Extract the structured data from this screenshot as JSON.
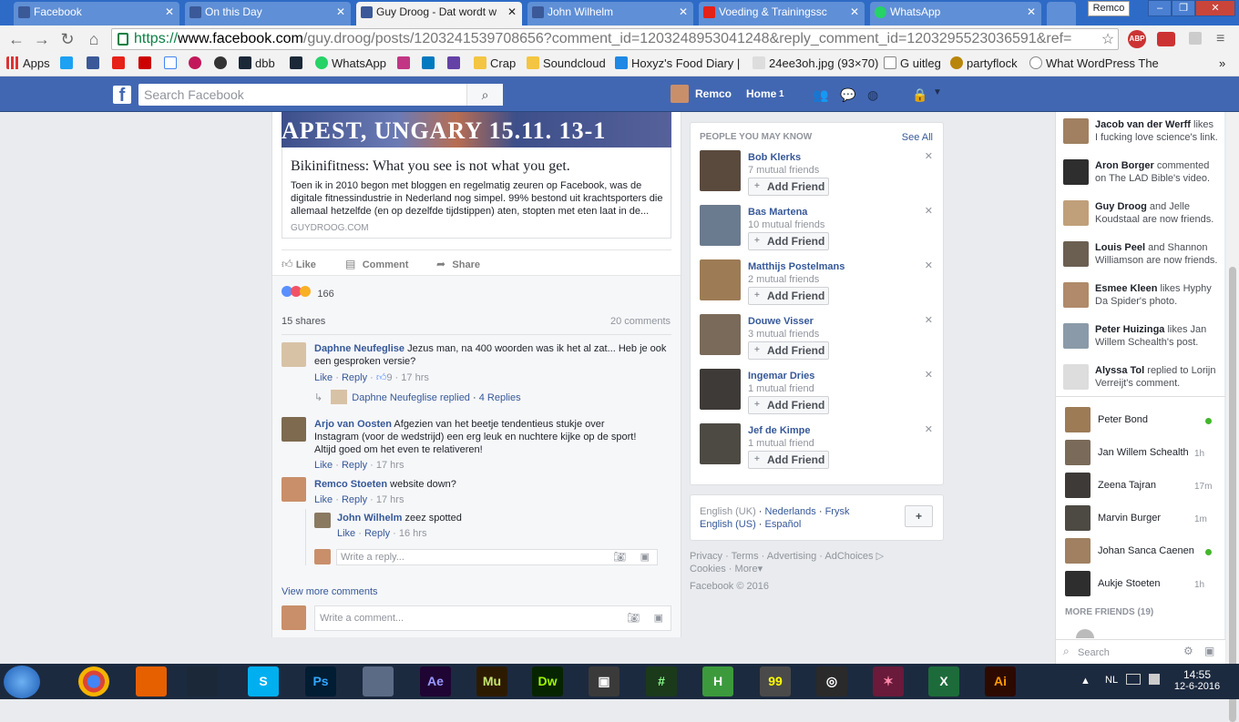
{
  "browser": {
    "tabs": [
      {
        "title": "Facebook",
        "color": "#3b5998",
        "active": false
      },
      {
        "title": "On this Day",
        "color": "#3b5998",
        "active": false
      },
      {
        "title": "Guy Droog - Dat wordt w",
        "color": "#3b5998",
        "active": true
      },
      {
        "title": "John Wilhelm",
        "color": "#3b5998",
        "active": false
      },
      {
        "title": "Voeding & Trainingssc",
        "color": "#e62117",
        "active": false
      },
      {
        "title": "WhatsApp",
        "color": "#25d366",
        "active": false
      }
    ],
    "profile": "Remco",
    "url_scheme": "https://",
    "url_host": "www.facebook.com",
    "url_path": "/guy.droog/posts/1203241539708656?comment_id=1203248953041248&reply_comment_id=1203295523036591&ref=",
    "bookmarks": [
      "Apps",
      "dbb",
      "WhatsApp",
      "Crap",
      "Soundcloud",
      "Hoxyz's Food Diary |",
      "24ee3oh.jpg (93×70)",
      "G uitleg",
      "partyflock",
      "What WordPress The"
    ]
  },
  "fb_header": {
    "search_placeholder": "Search Facebook",
    "user": "Remco",
    "home": "Home",
    "home_count": "1"
  },
  "post": {
    "image_text": "APEST, UNGARY 15.11. 13-1",
    "link_title": "Bikinifitness: What you see is not what you get.",
    "link_desc": "Toen ik in 2010 begon met bloggen en regelmatig zeuren op Facebook, was de digitale fitnessindustrie in Nederland nog simpel. 99% bestond uit krachtsporters die allemaal hetzelfde (en op dezelfde tijdstippen) aten, stopten met eten laat in de...",
    "link_domain": "GUYDROOG.COM",
    "like": "Like",
    "comment": "Comment",
    "share": "Share",
    "reactions_count": "166",
    "shares": "15 shares",
    "comments_count": "20 comments",
    "view_more": "View more comments",
    "write_comment": "Write a comment...",
    "write_reply": "Write a reply..."
  },
  "comments": [
    {
      "name": "Daphne Neufeglise",
      "text": "Jezus man, na 400 woorden was ik het al zat... Heb je ook een gesproken versie?",
      "like": "Like",
      "reply": "Reply",
      "likes": "9",
      "time": "17 hrs",
      "replied_by": "Daphne Neufeglise replied",
      "replies": "4 Replies"
    },
    {
      "name": "Arjo van Oosten",
      "text": "Afgezien van het beetje tendentieus stukje over Instagram (voor de wedstrijd) een erg leuk en nuchtere kijke op de sport! Altijd goed om het even te relativeren!",
      "like": "Like",
      "reply": "Reply",
      "time": "17 hrs"
    },
    {
      "name": "Remco Stoeten",
      "text": "website down?",
      "like": "Like",
      "reply": "Reply",
      "time": "17 hrs"
    },
    {
      "name": "John Wilhelm",
      "text": "zeez spotted",
      "like": "Like",
      "reply": "Reply",
      "time": "16 hrs"
    }
  ],
  "pymk": {
    "title": "PEOPLE YOU MAY KNOW",
    "see_all": "See All",
    "add_label": "Add Friend",
    "people": [
      {
        "name": "Bob Klerks",
        "mutual": "7 mutual friends"
      },
      {
        "name": "Bas Martena",
        "mutual": "10 mutual friends"
      },
      {
        "name": "Matthijs Postelmans",
        "mutual": "2 mutual friends"
      },
      {
        "name": "Douwe Visser",
        "mutual": "3 mutual friends"
      },
      {
        "name": "Ingemar Dries",
        "mutual": "1 mutual friend"
      },
      {
        "name": "Jef de Kimpe",
        "mutual": "1 mutual friend"
      }
    ]
  },
  "languages": {
    "current": "English (UK)",
    "others": [
      "Nederlands",
      "Frysk",
      "English (US)",
      "Español"
    ]
  },
  "footer": {
    "links": [
      "Privacy",
      "Terms",
      "Advertising",
      "AdChoices",
      "Cookies",
      "More"
    ],
    "copyright": "Facebook © 2016"
  },
  "ticker": [
    {
      "name": "Jacob van der Werff",
      "text": " likes I fucking love science's link."
    },
    {
      "name": "Aron Borger",
      "text": " commented on The LAD Bible's video."
    },
    {
      "name": "Guy Droog",
      "text": " and Jelle Koudstaal are now friends."
    },
    {
      "name": "Louis Peel",
      "text": " and Shannon Williamson are now friends."
    },
    {
      "name": "Esmee Kleen",
      "text": " likes Hyphy Da Spider's photo."
    },
    {
      "name": "Peter Huizinga",
      "text": " likes Jan Willem Schealth's post."
    },
    {
      "name": "Alyssa Tol",
      "text": " replied to Lorijn Verreijt's comment."
    }
  ],
  "chat": {
    "friends": [
      {
        "name": "Peter Bond",
        "status": "online"
      },
      {
        "name": "Jan Willem Schealth",
        "status": "1h"
      },
      {
        "name": "Zeena Tajran",
        "status": "17m"
      },
      {
        "name": "Marvin Burger",
        "status": "1m"
      },
      {
        "name": "Johan Sanca Caenen",
        "status": "online"
      },
      {
        "name": "Aukje Stoeten",
        "status": "1h"
      }
    ],
    "more_friends": "MORE FRIENDS (19)",
    "search_placeholder": "Search"
  },
  "taskbar": {
    "lang": "NL",
    "time": "14:55",
    "date": "12-6-2016",
    "apps": [
      "Chrome",
      "Firefox",
      "Steam",
      "Skype",
      "Ps",
      "Remote",
      "Ae",
      "Mu",
      "Dw",
      "Video",
      "Hash",
      "H",
      "99",
      "Steering",
      "Game",
      "X",
      "Ai"
    ]
  }
}
